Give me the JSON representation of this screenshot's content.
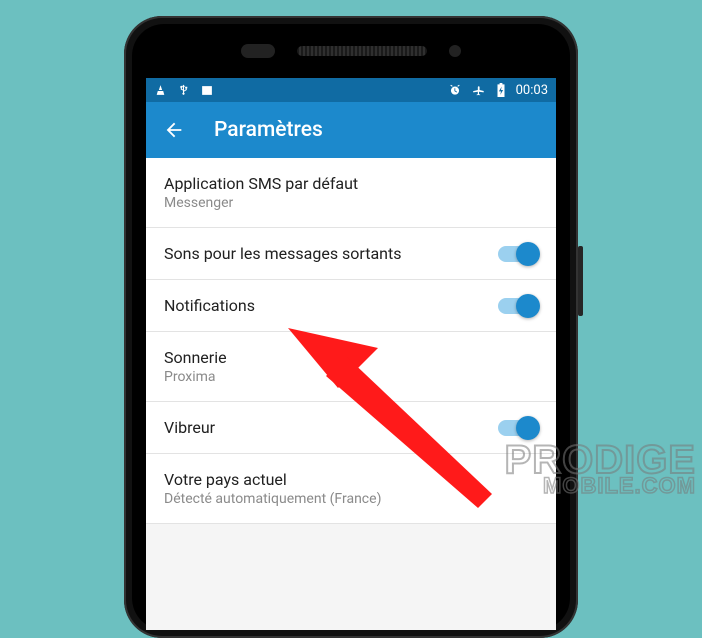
{
  "status_bar": {
    "left_icons": [
      "vlc-icon",
      "usb-icon",
      "picture-icon"
    ],
    "right_icons": [
      "alarm-icon",
      "airplane-icon",
      "battery-charging-icon"
    ],
    "time": "00:03"
  },
  "app_bar": {
    "title": "Paramètres"
  },
  "settings": [
    {
      "primary": "Application SMS par défaut",
      "secondary": "Messenger",
      "type": "link"
    },
    {
      "primary": "Sons pour les messages sortants",
      "type": "switch",
      "on": true
    },
    {
      "primary": "Notifications",
      "type": "switch",
      "on": true
    },
    {
      "primary": "Sonnerie",
      "secondary": "Proxima",
      "type": "link"
    },
    {
      "primary": "Vibreur",
      "type": "switch",
      "on": true
    },
    {
      "primary": "Votre pays actuel",
      "secondary": "Détecté automatiquement (France)",
      "type": "link"
    }
  ],
  "watermark": {
    "line1": "PRODIGE",
    "line2": "MOBILE.COM"
  }
}
